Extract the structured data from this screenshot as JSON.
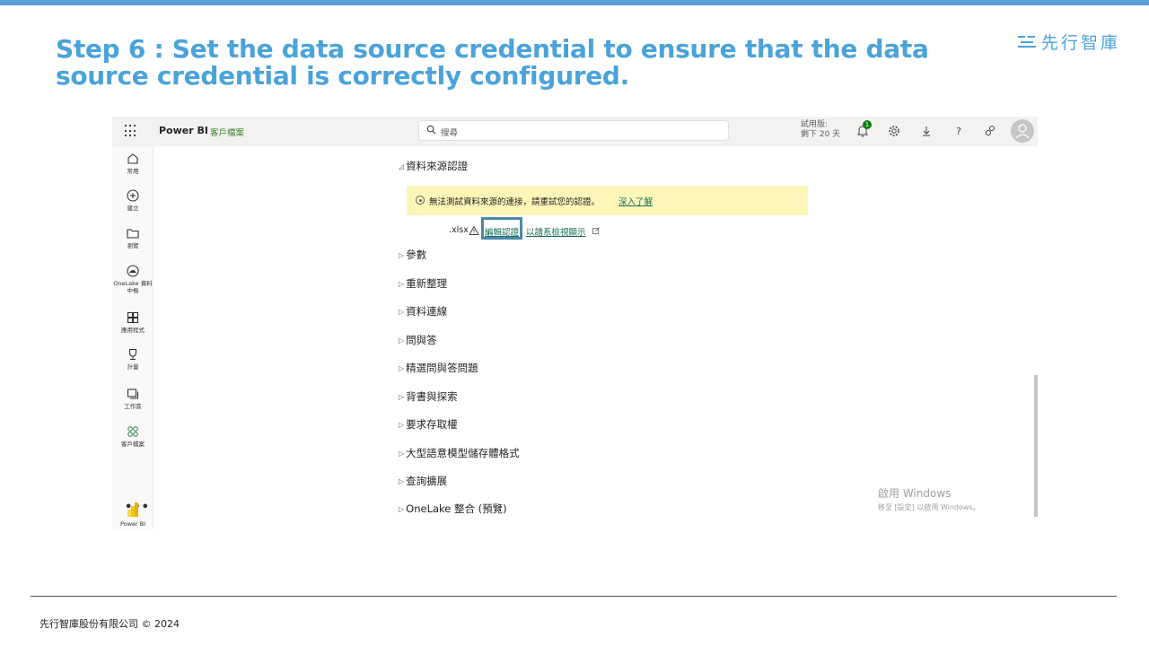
{
  "slide": {
    "title": "Step 6 : Set the data source credential to ensure that the data source credential is correctly configured.",
    "logo_text": "先行智庫",
    "footer": "先行智庫股份有限公司 © 2024"
  },
  "header": {
    "brand": "Power BI",
    "workspace": "客戶檔案",
    "search_placeholder": "搜尋",
    "trial_line1": "試用版:",
    "trial_line2": "剩下 20 天",
    "notification_count": "1",
    "icons": [
      "app-launcher-icon",
      "bell-icon",
      "gear-icon",
      "download-icon",
      "help-icon",
      "share-icon",
      "avatar-icon"
    ]
  },
  "nav": {
    "items": [
      {
        "label": "常用",
        "icon": "home-icon"
      },
      {
        "label": "建立",
        "icon": "plus-circle-icon"
      },
      {
        "label": "瀏覽",
        "icon": "folder-icon"
      },
      {
        "label": "OneLake 資料中樞",
        "icon": "onelake-icon"
      },
      {
        "label": "應用程式",
        "icon": "apps-icon"
      },
      {
        "label": "計量",
        "icon": "trophy-icon"
      },
      {
        "label": "工作區",
        "icon": "workspace-icon"
      },
      {
        "label": "客戶檔案",
        "icon": "workspace-people-icon"
      }
    ],
    "more": "•••",
    "bottom_label": "Power BI"
  },
  "settings": {
    "expanded_section": "資料來源認證",
    "warning_text": "無法測試資料來源的連接，請重試您的認證。",
    "warning_link": "深入了解",
    "file_ext": ".xlsx",
    "edit_credentials": "編輯認證",
    "show_in_lineage": "以譜系檢視顯示",
    "collapsed_sections": [
      "參數",
      "重新整理",
      "資料連線",
      "問與答",
      "精選問與答問題",
      "背書與探索",
      "要求存取權",
      "大型語意模型儲存體格式",
      "查詢擴展",
      "OneLake 整合 (預覽)"
    ]
  },
  "windows_activation": {
    "line1": "啟用 Windows",
    "line2": "移至 [設定] 以啟用 Windows。"
  },
  "colors": {
    "title": "#4aa3d9",
    "accent_green": "#107c10",
    "warning_bg": "#fbf6b8",
    "highlight_box": "#4a89a8"
  }
}
